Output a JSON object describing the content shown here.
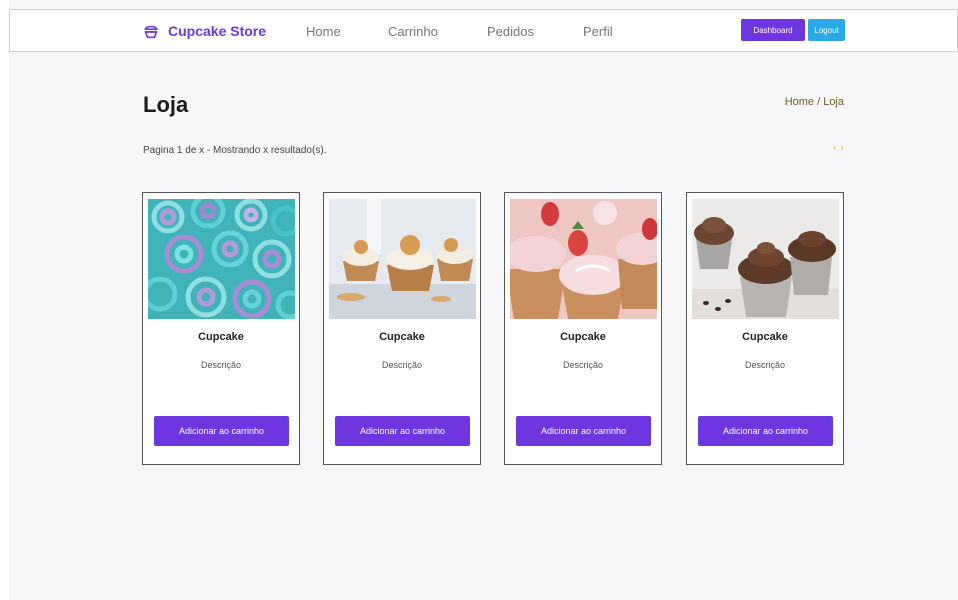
{
  "header": {
    "brand": "Cupcake Store",
    "nav": [
      "Home",
      "Carrinho",
      "Pedidos",
      "Perfil"
    ],
    "dashboard_label": "Dashboard",
    "logout_label": "Logout"
  },
  "main": {
    "title": "Loja",
    "breadcrumb": "Home / Loja",
    "results_info": "Pagina 1 de x - Mostrando x resultado(s).",
    "pager": "‹ ›"
  },
  "products": [
    {
      "name": "Cupcake",
      "description": "Descrição",
      "button": "Adicionar ao carrinho",
      "image": "teal-frosting-cupcakes"
    },
    {
      "name": "Cupcake",
      "description": "Descrição",
      "button": "Adicionar ao carrinho",
      "image": "waffle-cone-cupcakes"
    },
    {
      "name": "Cupcake",
      "description": "Descrição",
      "button": "Adicionar ao carrinho",
      "image": "strawberry-cupcakes"
    },
    {
      "name": "Cupcake",
      "description": "Descrição",
      "button": "Adicionar ao carrinho",
      "image": "chocolate-cupcakes"
    }
  ],
  "colors": {
    "accent": "#6d36e0",
    "logout": "#2aa8e8",
    "breadcrumb": "#6b5f1e",
    "pager": "#e0a100"
  },
  "icons": {
    "brand": "cupcake-icon"
  }
}
